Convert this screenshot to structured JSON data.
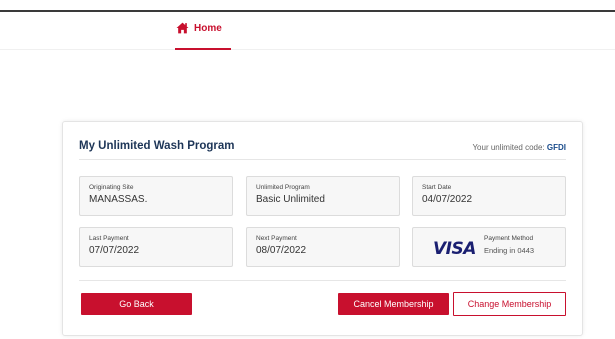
{
  "nav": {
    "home_label": "Home",
    "home_icon": "home-icon",
    "accent_color": "#c8102e"
  },
  "card": {
    "title": "My Unlimited Wash Program",
    "code_label": "Your unlimited code:",
    "code_value": "GFDI",
    "fields": {
      "originating_site": {
        "label": "Originating Site",
        "value": "MANASSAS."
      },
      "unlimited_program": {
        "label": "Unlimited Program",
        "value": "Basic Unlimited"
      },
      "start_date": {
        "label": "Start Date",
        "value": "04/07/2022"
      },
      "last_payment": {
        "label": "Last Payment",
        "value": "07/07/2022"
      },
      "next_payment": {
        "label": "Next Payment",
        "value": "08/07/2022"
      },
      "payment_method": {
        "label": "Payment Method",
        "value": "Ending in 0443",
        "brand": "VISA"
      }
    },
    "buttons": {
      "go_back": "Go Back",
      "cancel": "Cancel Membership",
      "change": "Change Membership"
    }
  }
}
